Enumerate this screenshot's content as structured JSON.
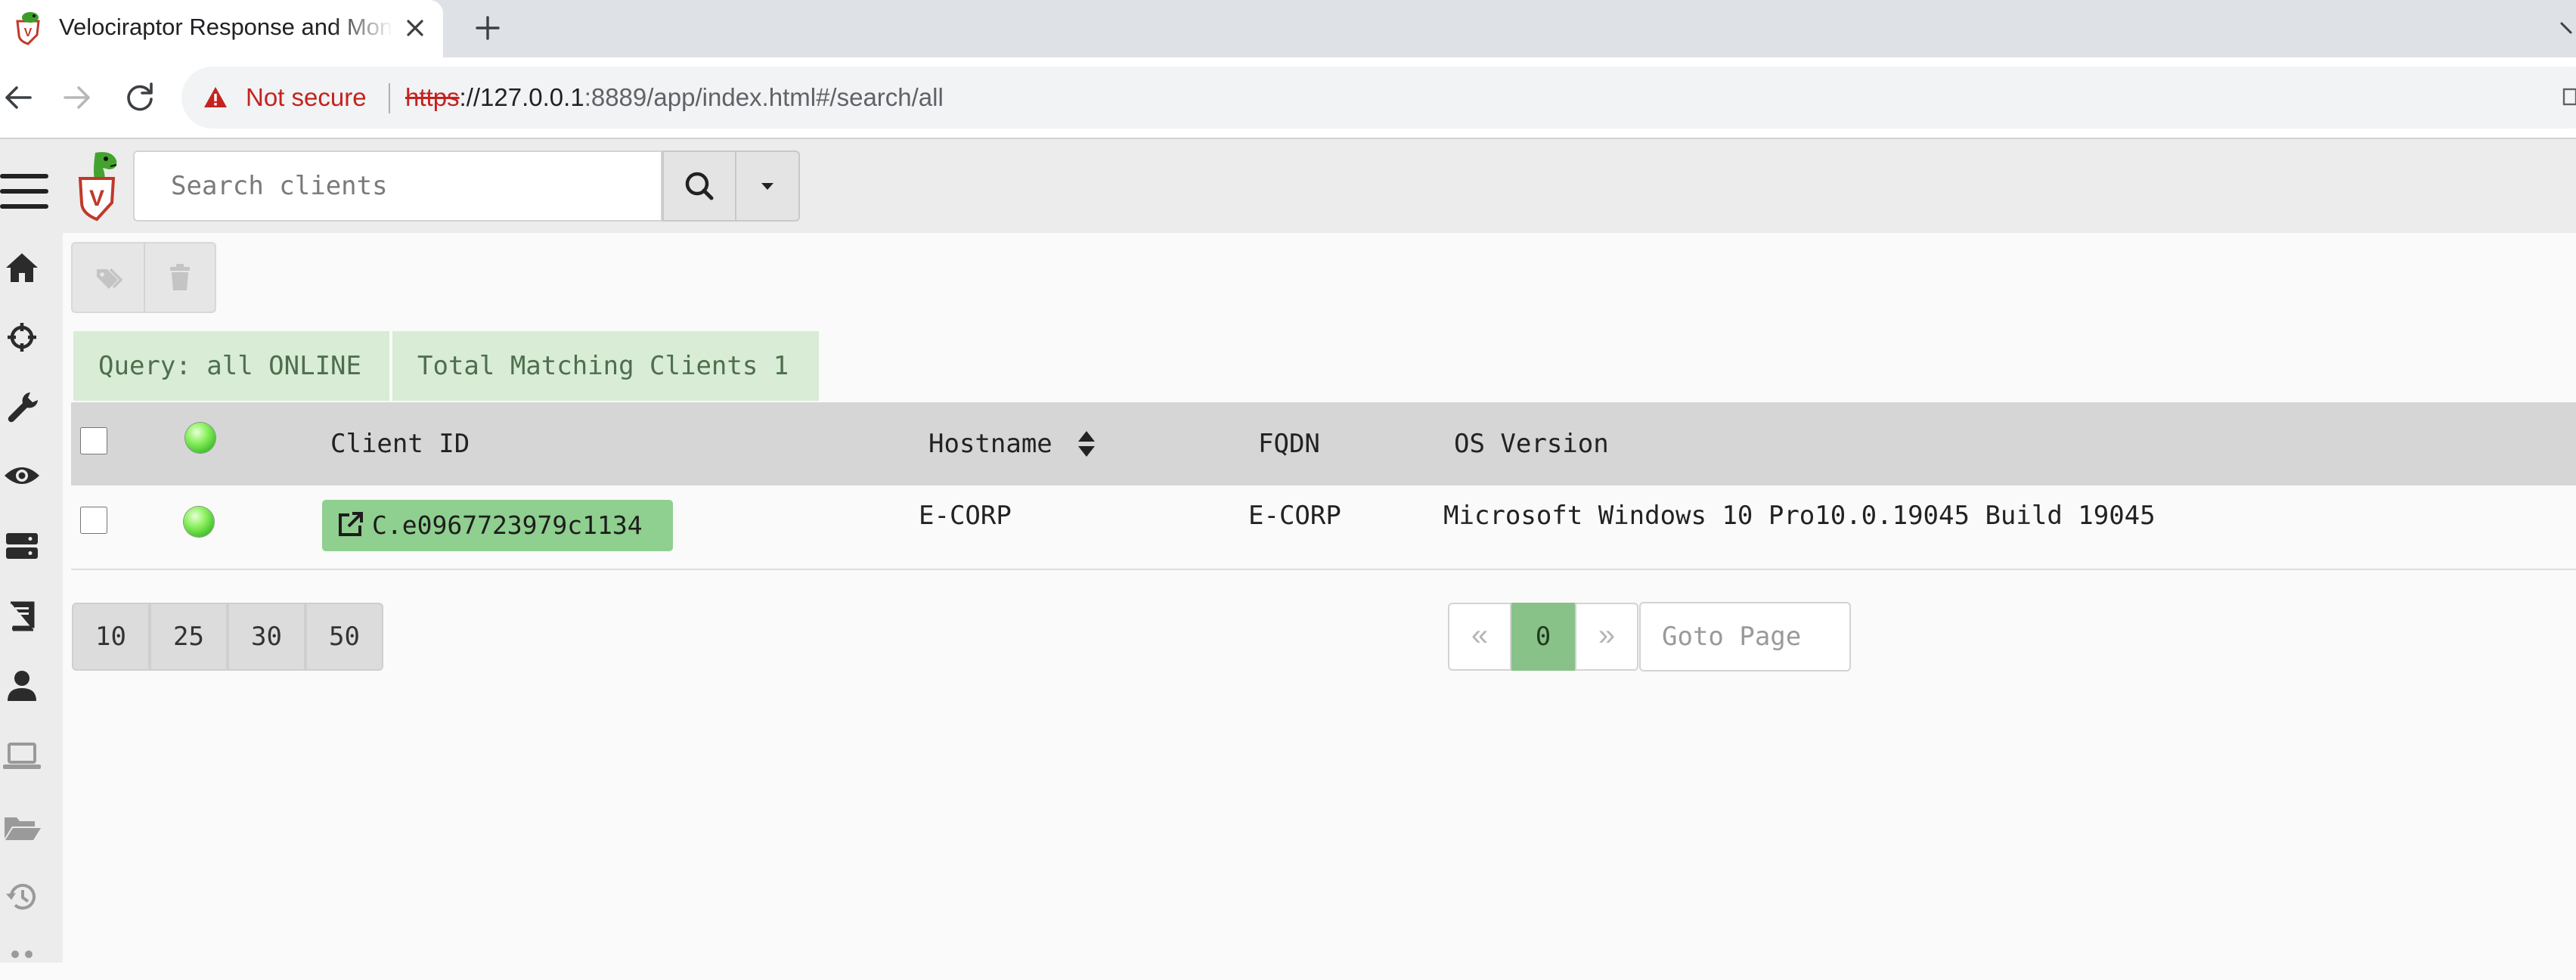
{
  "browser": {
    "tab_title": "Velociraptor Response and Monitoring",
    "security_label": "Not secure",
    "url_scheme": "https",
    "url_host": "://127.0.0.1",
    "url_rest": ":8889/app/index.html#/search/all"
  },
  "search": {
    "placeholder": "Search clients"
  },
  "badges": {
    "query": "Query: all ONLINE",
    "total": "Total Matching Clients 1"
  },
  "table": {
    "columns": [
      "Client ID",
      "Hostname",
      "FQDN",
      "OS Version"
    ],
    "rows": [
      {
        "client_id": "C.e0967723979c1134",
        "hostname": "E-CORP",
        "fqdn": "E-CORP",
        "os_version": "Microsoft Windows 10 Pro10.0.19045 Build 19045",
        "status_color": "#4fd13a"
      }
    ]
  },
  "pagination": {
    "page_sizes": [
      "10",
      "25",
      "30",
      "50"
    ],
    "prev": "«",
    "current_page": "0",
    "next": "»",
    "goto_placeholder": "Goto Page"
  },
  "sidebar": {
    "icons": [
      "home-icon",
      "crosshairs-icon",
      "wrench-icon",
      "eye-icon",
      "server-icon",
      "book-icon",
      "user-icon",
      "laptop-icon",
      "folder-open-icon",
      "history-icon"
    ]
  },
  "colors": {
    "badge_bg": "#d9ecd6",
    "client_link_bg": "#8fcf8f",
    "current_page_bg": "#88c288",
    "not_secure": "#c5221f"
  }
}
